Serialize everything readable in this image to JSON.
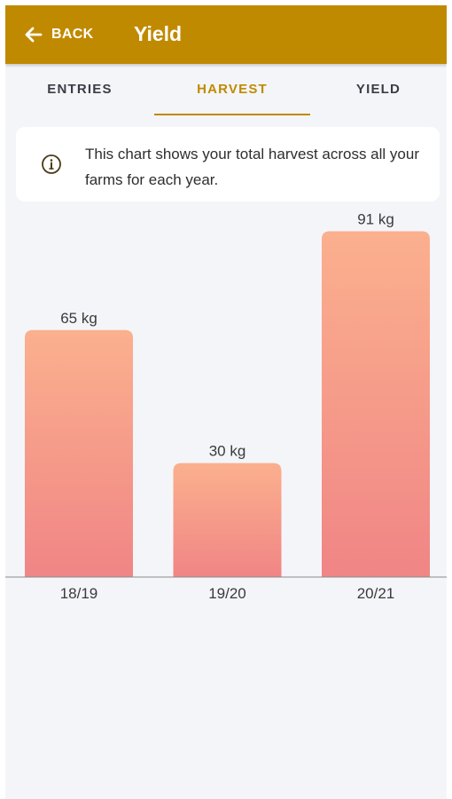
{
  "header": {
    "back_label": "BACK",
    "title": "Yield",
    "color": "#c08a00"
  },
  "tabs": [
    {
      "label": "ENTRIES",
      "active": false
    },
    {
      "label": "HARVEST",
      "active": true
    },
    {
      "label": "YIELD",
      "active": false
    }
  ],
  "info": {
    "icon": "info-icon",
    "text": "This chart shows your total harvest across all your farms for each year."
  },
  "chart_data": {
    "type": "bar",
    "categories": [
      "18/19",
      "19/20",
      "20/21"
    ],
    "values": [
      65,
      30,
      91
    ],
    "value_labels": [
      "65 kg",
      "30 kg",
      "91 kg"
    ],
    "unit": "kg",
    "bar_gradient": [
      "#fbb08e",
      "#f08585"
    ],
    "ylim": [
      0,
      100
    ]
  }
}
